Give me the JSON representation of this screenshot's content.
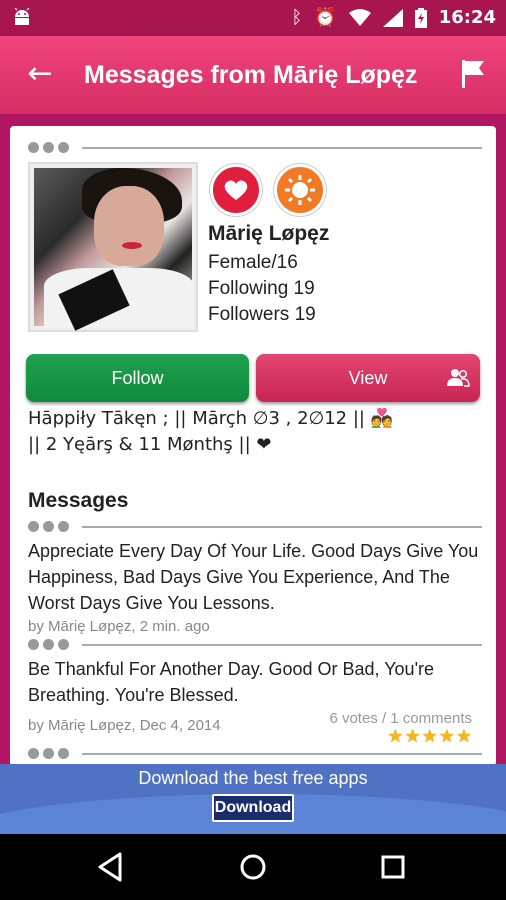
{
  "status_bar": {
    "icons": [
      "android-icon",
      "bluetooth-icon",
      "alarm-icon",
      "wifi-icon",
      "signal-icon",
      "battery-icon"
    ],
    "time": "16:24"
  },
  "app_bar": {
    "title": "Messages from Mārię Løpęz",
    "back_icon": "back-arrow-icon",
    "flag_icon": "flag-icon",
    "color": "#e23a70"
  },
  "profile": {
    "name": "Mārię Løpęz",
    "gender_age": "Female/16",
    "following": "Following 19",
    "followers": "Followers 19",
    "badges": [
      "heart-badge-icon",
      "sun-badge-icon"
    ]
  },
  "buttons": {
    "follow_label": "Follow",
    "view_label": "View"
  },
  "status_text": {
    "line1": "Hāppiły Tākęn ; || Mārçh ∅3 , 2∅12 || 💑",
    "line2": " || 2 Yęārş & 11 Mønthş || ❤"
  },
  "messages_section": {
    "title": "Messages",
    "items": [
      {
        "text": "Appreciate Every Day Of Your Life. Good Days Give You Happiness, Bad Days Give You Experience, And The Worst Days Give You Lessons.",
        "meta": "by Mārię Løpęz, 2 min. ago"
      },
      {
        "text": "Be Thankful For Another Day. Good Or Bad, You're Breathing. You're Blessed.",
        "meta": "by Mārię Løpęz, Dec 4, 2014",
        "votes": "6 votes / 1 comments",
        "stars": 5
      }
    ]
  },
  "ad_banner": {
    "text": "Download the best free apps",
    "button": "Download"
  },
  "nav_bar": {
    "icons": [
      "back-triangle-icon",
      "home-circle-icon",
      "recents-square-icon"
    ]
  }
}
